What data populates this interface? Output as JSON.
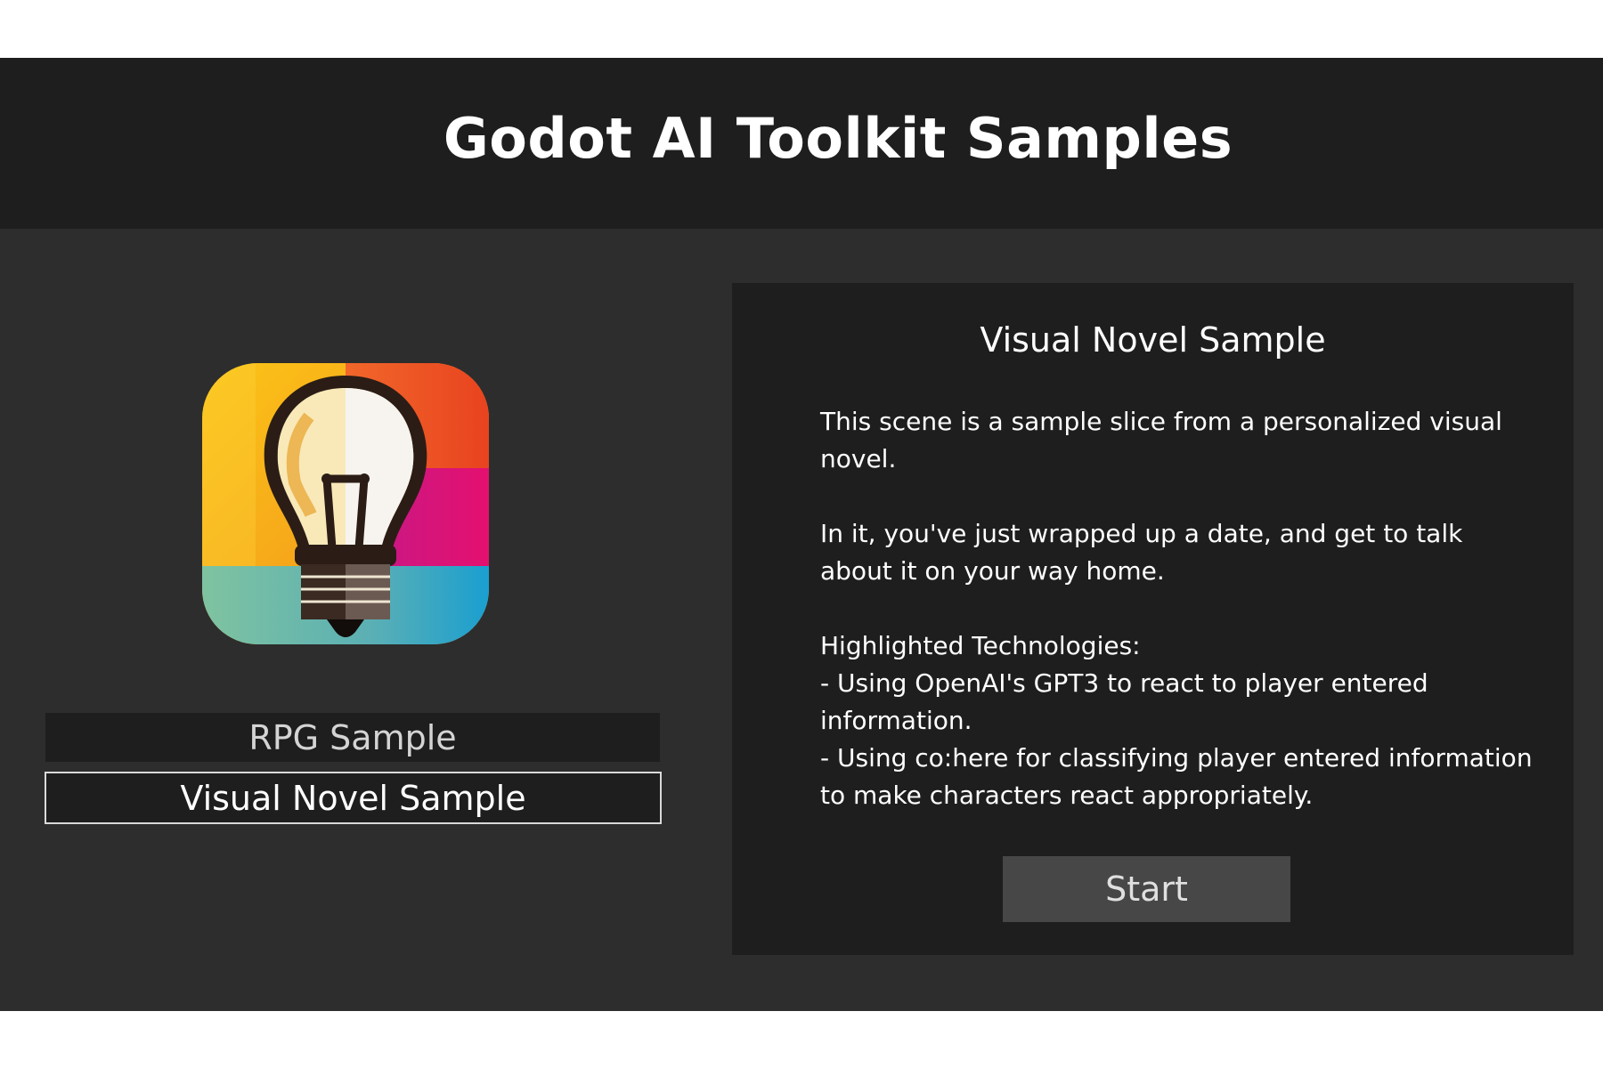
{
  "header": {
    "title": "Godot AI Toolkit Samples"
  },
  "logo": {
    "icon": "lightbulb-icon",
    "colors": [
      "#f8b61e",
      "#e94e24",
      "#e0127a",
      "#1fa3c9",
      "#6fbf9e"
    ]
  },
  "sample_list": {
    "items": [
      {
        "label": "RPG Sample",
        "selected": false
      },
      {
        "label": "Visual Novel Sample",
        "selected": true
      }
    ]
  },
  "detail": {
    "title": "Visual Novel Sample",
    "paragraph_1": "This scene is a sample slice from a personalized visual novel.",
    "paragraph_2": "In it, you've just wrapped up a date, and get to talk about it on your way home.",
    "tech_heading": "Highlighted Technologies:",
    "tech_1": "- Using OpenAI's GPT3 to react to player entered information.",
    "tech_2": "- Using co:here for classifying player entered information to make characters react appropriately.",
    "start_label": "Start"
  },
  "theme": {
    "background": "#2d2d2d",
    "panel": "#1e1e1e",
    "button": "#474747",
    "text": "#ffffff"
  }
}
